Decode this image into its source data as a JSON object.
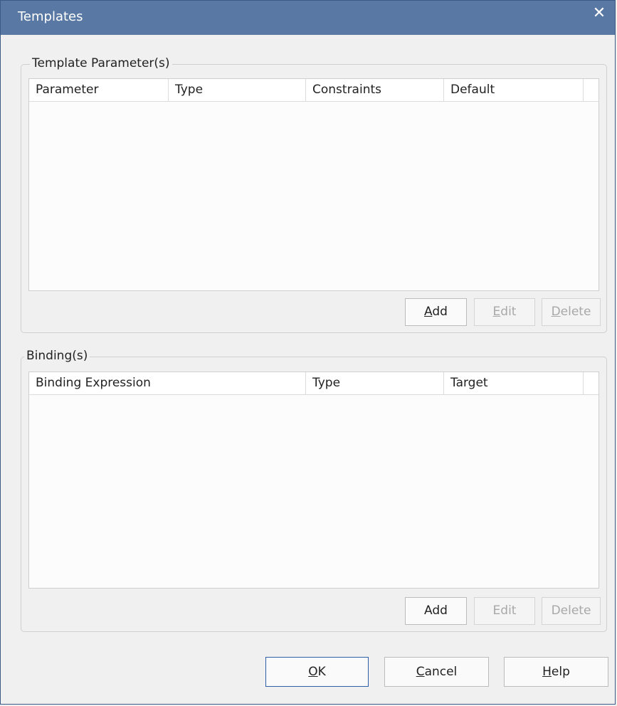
{
  "window": {
    "title": "Templates"
  },
  "template_parameters": {
    "legend": "Template Parameter(s)",
    "columns": [
      "Parameter",
      "Type",
      "Constraints",
      "Default"
    ],
    "rows": [],
    "buttons": {
      "add": {
        "mn": "A",
        "rest": "dd"
      },
      "edit": {
        "mn": "E",
        "rest": "dit"
      },
      "delete": {
        "mn": "D",
        "rest": "elete"
      }
    }
  },
  "bindings": {
    "legend": "Binding(s)",
    "columns": [
      "Binding Expression",
      "Type",
      "Target"
    ],
    "rows": [],
    "buttons": {
      "add": "Add",
      "edit": "Edit",
      "delete": "Delete"
    }
  },
  "footer": {
    "ok": {
      "mn": "O",
      "rest": "K"
    },
    "cancel": {
      "mn": "C",
      "rest": "ancel"
    },
    "help": {
      "mn": "H",
      "rest": "elp"
    }
  }
}
